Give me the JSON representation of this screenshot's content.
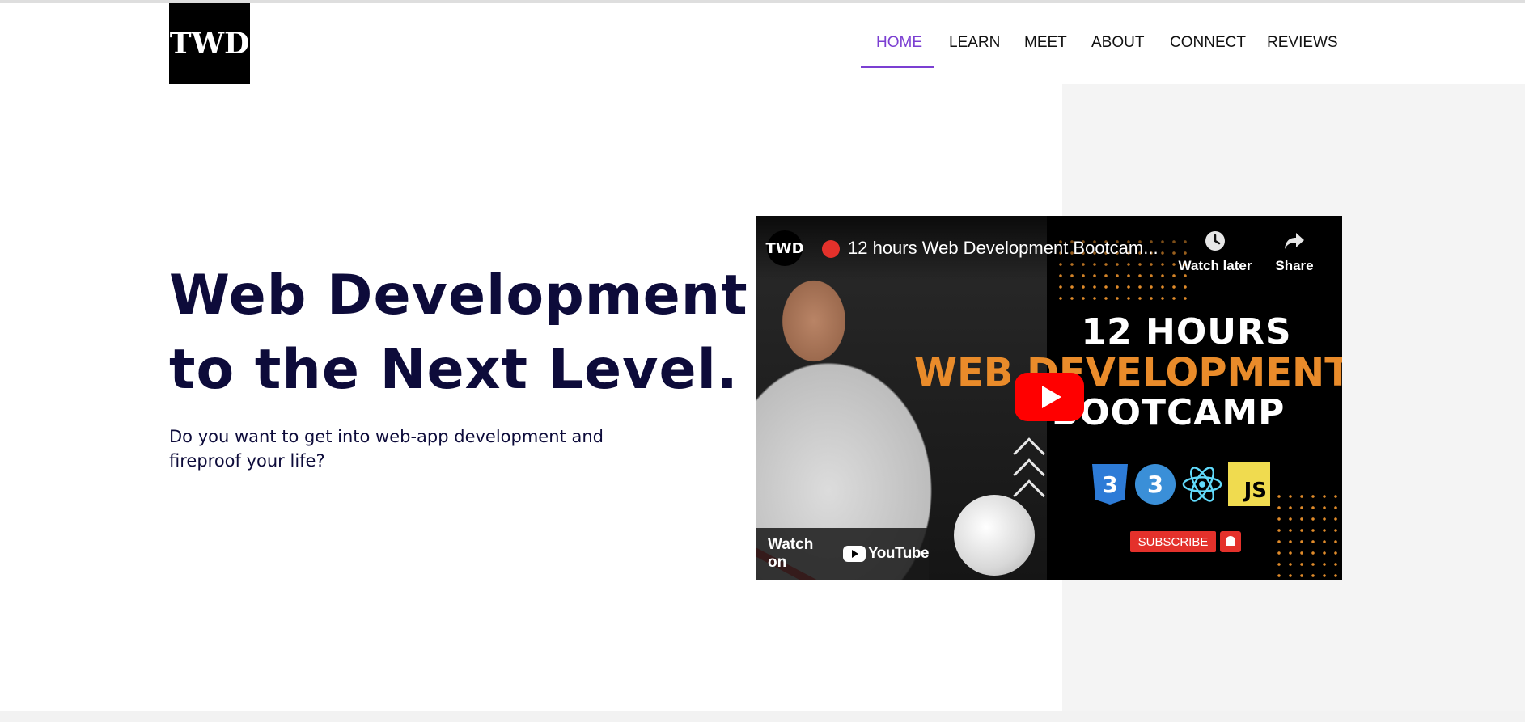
{
  "header": {
    "logo_text": "TWD",
    "nav": [
      {
        "label": "HOME",
        "active": true
      },
      {
        "label": "LEARN",
        "active": false
      },
      {
        "label": "MEET",
        "active": false
      },
      {
        "label": "ABOUT",
        "active": false
      },
      {
        "label": "CONNECT",
        "active": false
      },
      {
        "label": "REVIEWS",
        "active": false
      }
    ]
  },
  "hero": {
    "title_line1": "Web Development",
    "title_line2": "to the Next Level.",
    "subtitle": "Do you want to get into web-app development and fireproof your life?"
  },
  "video": {
    "channel_badge": "TWD",
    "title": "12 hours Web Development Bootcam...",
    "watch_later_label": "Watch later",
    "share_label": "Share",
    "thumb_line1": "12 HOURS",
    "thumb_line2": "WEB DEVELOPMENT",
    "thumb_line3": "BOOTCAMP",
    "tech_logos": [
      "css3-icon",
      "css3-icon",
      "react-icon",
      "js-icon"
    ],
    "js_label": "JS",
    "subscribe_label": "SUBSCRIBE",
    "watch_on_label": "Watch on",
    "youtube_label": "YouTube"
  },
  "colors": {
    "accent": "#7b3fd2",
    "heading": "#0d0b3a",
    "orange": "#e98b2a",
    "youtube_red": "#ff0000"
  }
}
